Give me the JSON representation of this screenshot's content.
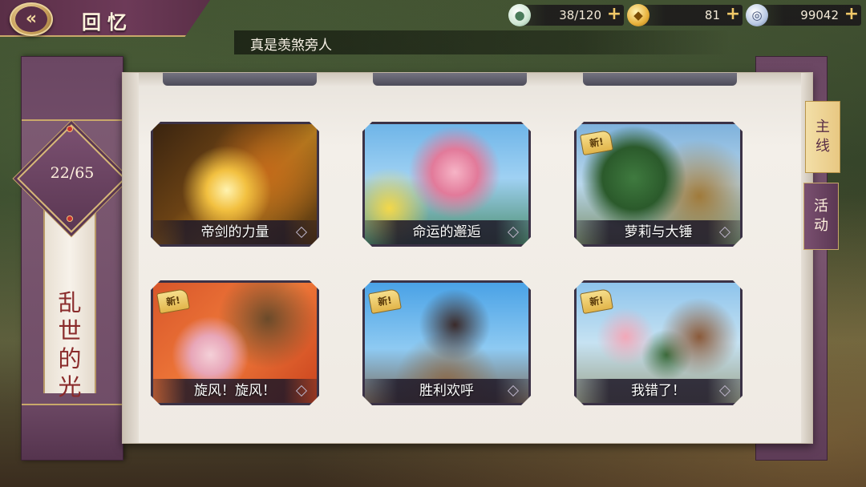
{
  "header": {
    "title": "回忆",
    "back_icon": "back-arrow-icon"
  },
  "resources": {
    "stamina": {
      "icon": "steamed-bun-icon",
      "value": "38/120"
    },
    "gold": {
      "icon": "gold-ingot-icon",
      "value": "81"
    },
    "silver": {
      "icon": "silver-coin-icon",
      "value": "99042"
    },
    "plus_label": "+"
  },
  "subtitle": "真是羡煞旁人",
  "chapter": {
    "counter": "22/65",
    "name": "乱世的光影"
  },
  "cards": [
    {
      "caption": "帝剑的力量",
      "new": false
    },
    {
      "caption": "命运的邂逅",
      "new": false
    },
    {
      "caption": "萝莉与大锤",
      "new": true
    },
    {
      "caption": "旋风！旋风！",
      "new": true
    },
    {
      "caption": "胜利欢呼",
      "new": true
    },
    {
      "caption": "我错了！",
      "new": true
    }
  ],
  "new_badge_label": "新!",
  "tabs": {
    "main": "主线",
    "event": "活动"
  }
}
